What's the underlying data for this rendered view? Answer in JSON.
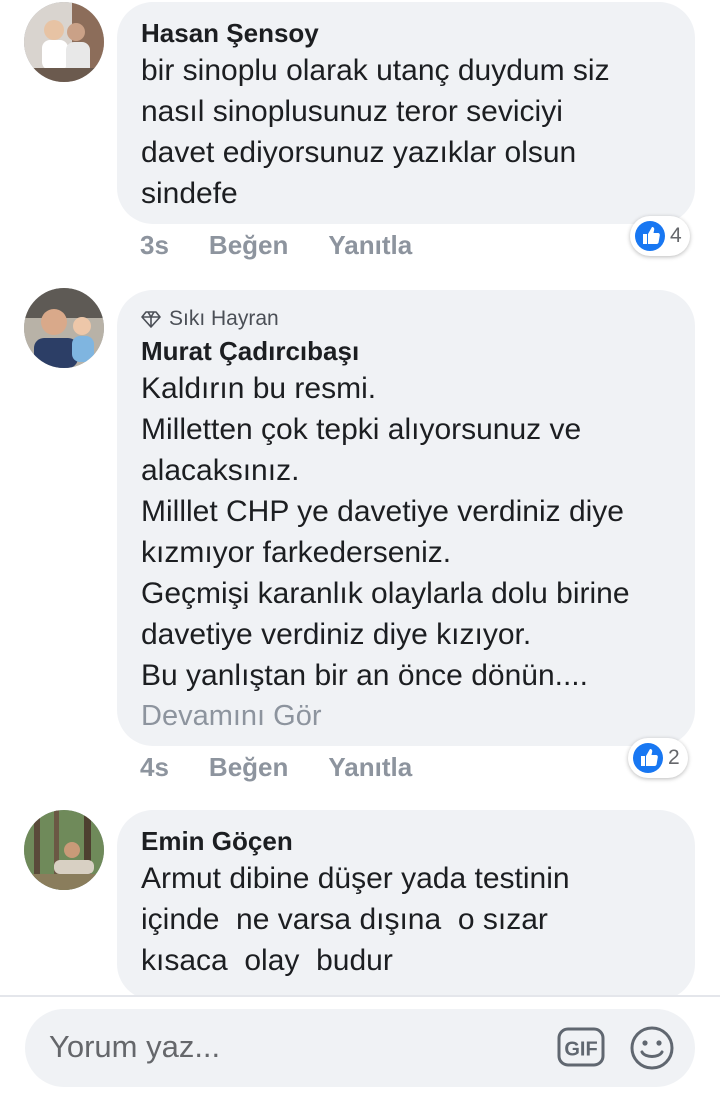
{
  "comments": [
    {
      "author": "Hasan Şensoy",
      "lines": "bir sinoplu olarak utanç duydum siz\nnasıl sinoplusunuz teror seviciyi\ndavet ediyorsunuz yazıklar olsun\nsindefe",
      "time": "3s",
      "like_label": "Beğen",
      "reply_label": "Yanıtla",
      "reaction_count": "4"
    },
    {
      "badge": "Sıkı Hayran",
      "author": "Murat Çadırcıbaşı",
      "lines": "Kaldırın bu resmi.\nMilletten çok tepki alıyorsunuz ve\nalacaksınız.\nMilllet CHP ye davetiye verdiniz diye\nkızmıyor farkederseniz.\nGeçmişi karanlık olaylarla dolu birine\ndavetiye verdiniz diye kızıyor.\nBu yanlıştan bir an önce dönün....",
      "see_more": "Devamını Gör",
      "time": "4s",
      "like_label": "Beğen",
      "reply_label": "Yanıtla",
      "reaction_count": "2"
    },
    {
      "author": "Emin Göçen",
      "lines": "Armut dibine düşer yada testinin\niçinde  ne varsa dışına  o sızar\nkısaca  olay  budur"
    }
  ],
  "composer": {
    "placeholder": "Yorum yaz...",
    "gif_label": "GIF"
  },
  "colors": {
    "bubble": "#f0f2f5",
    "meta": "#8d949e",
    "like_blue": "#1877f2"
  },
  "icons": [
    "diamond-icon",
    "like-reaction-icon",
    "gif-icon",
    "emoji-icon"
  ]
}
